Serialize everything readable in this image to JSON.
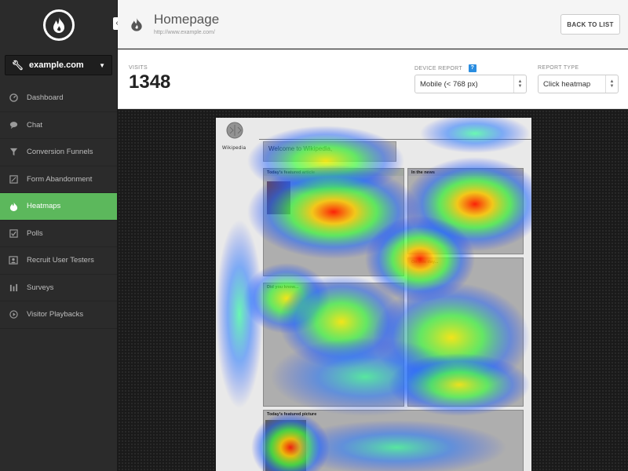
{
  "sidebar": {
    "site": "example.com",
    "items": [
      {
        "label": "Dashboard",
        "icon": "dashboard-icon"
      },
      {
        "label": "Chat",
        "icon": "chat-icon"
      },
      {
        "label": "Conversion Funnels",
        "icon": "funnel-icon"
      },
      {
        "label": "Form Abandonment",
        "icon": "form-icon"
      },
      {
        "label": "Heatmaps",
        "icon": "flame-icon",
        "active": true
      },
      {
        "label": "Polls",
        "icon": "poll-icon"
      },
      {
        "label": "Recruit User Testers",
        "icon": "user-card-icon"
      },
      {
        "label": "Surveys",
        "icon": "survey-icon"
      },
      {
        "label": "Visitor Playbacks",
        "icon": "play-icon"
      }
    ]
  },
  "header": {
    "title": "Homepage",
    "url": "http://www.example.com/",
    "back_label": "BACK TO LIST"
  },
  "stats": {
    "visits_label": "VISITS",
    "visits_value": "1348",
    "device_label": "DEVICE REPORT",
    "device_value": "Mobile (< 768 px)",
    "report_type_label": "REPORT TYPE",
    "report_type_value": "Click heatmap"
  },
  "wiki": {
    "title": "Wikipedia",
    "welcome": "Welcome to Wikipedia,",
    "featured_article": "Today's featured article",
    "in_the_news": "In the news",
    "did_you_know": "Did you know...",
    "on_this_day": "On this day...",
    "featured_picture": "Today's featured picture"
  },
  "colors": {
    "sidebar_bg": "#2b2b2b",
    "active": "#5cb85c",
    "help": "#2a8de0"
  }
}
